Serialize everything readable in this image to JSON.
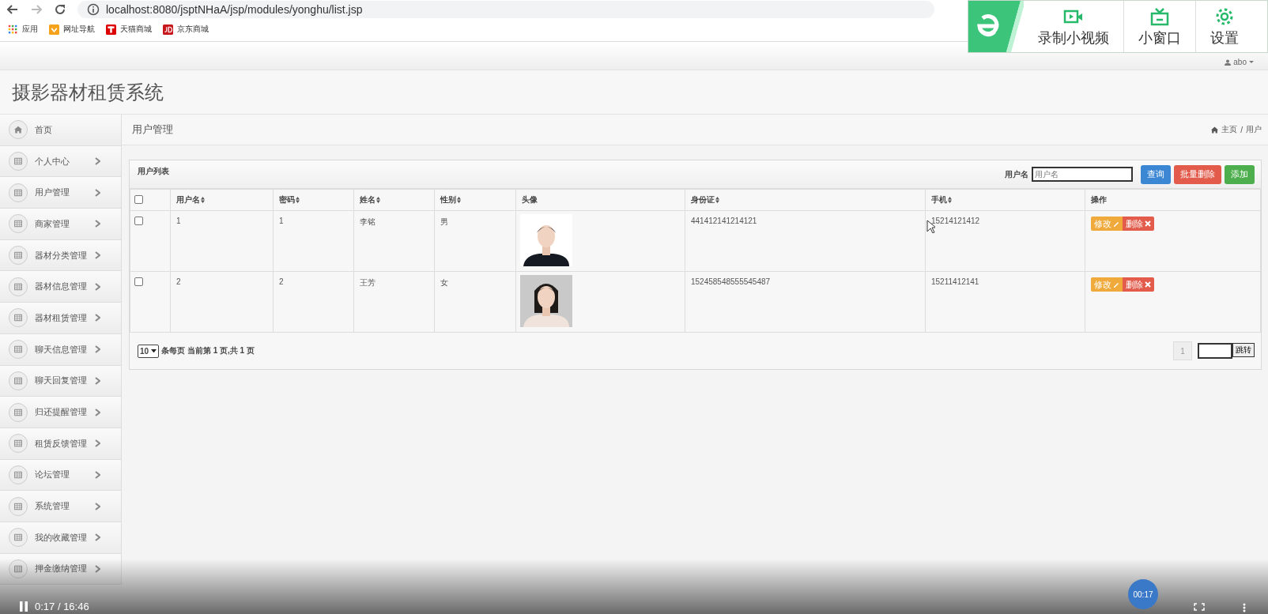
{
  "browser": {
    "url": "localhost:8080/jsptNHaA/jsp/modules/yonghu/list.jsp",
    "bookmarks": [
      {
        "label": "应用",
        "kind": "apps"
      },
      {
        "label": "网址导航",
        "kind": "nav"
      },
      {
        "label": "天猫商城",
        "kind": "tmall"
      },
      {
        "label": "京东商城",
        "kind": "jd"
      }
    ]
  },
  "extension_toolbar": {
    "items": [
      {
        "label": "录制小视频",
        "kind": "record"
      },
      {
        "label": "小窗口",
        "kind": "mini"
      },
      {
        "label": "设置",
        "kind": "settings"
      }
    ]
  },
  "header": {
    "user": "abo",
    "title": "摄影器材租赁系统"
  },
  "sidebar": {
    "items": [
      {
        "label": "首页",
        "kind": "home",
        "has_submenu": false
      },
      {
        "label": "个人中心",
        "kind": "table",
        "has_submenu": true
      },
      {
        "label": "用户管理",
        "kind": "table",
        "has_submenu": true
      },
      {
        "label": "商家管理",
        "kind": "table",
        "has_submenu": true
      },
      {
        "label": "器材分类管理",
        "kind": "table",
        "has_submenu": true
      },
      {
        "label": "器材信息管理",
        "kind": "table",
        "has_submenu": true
      },
      {
        "label": "器材租赁管理",
        "kind": "table",
        "has_submenu": true
      },
      {
        "label": "聊天信息管理",
        "kind": "table",
        "has_submenu": true
      },
      {
        "label": "聊天回复管理",
        "kind": "table",
        "has_submenu": true
      },
      {
        "label": "归还提醒管理",
        "kind": "table",
        "has_submenu": true
      },
      {
        "label": "租赁反馈管理",
        "kind": "table",
        "has_submenu": true
      },
      {
        "label": "论坛管理",
        "kind": "table",
        "has_submenu": true
      },
      {
        "label": "系统管理",
        "kind": "table",
        "has_submenu": true
      },
      {
        "label": "我的收藏管理",
        "kind": "table",
        "has_submenu": true
      },
      {
        "label": "押金缴纳管理",
        "kind": "table",
        "has_submenu": true
      }
    ]
  },
  "breadcrumb": {
    "page_title": "用户管理",
    "trail": [
      "主页",
      "用户"
    ],
    "separator": "/"
  },
  "panel": {
    "title": "用户列表",
    "search": {
      "label": "用户名",
      "placeholder": "用户名"
    },
    "buttons": [
      {
        "label": "查询",
        "kind": "query"
      },
      {
        "label": "批量删除",
        "kind": "batch_delete"
      },
      {
        "label": "添加",
        "kind": "add"
      }
    ]
  },
  "table": {
    "select_all": {
      "checked": false
    },
    "columns": [
      {
        "label": "用户名",
        "sortable": true
      },
      {
        "label": "密码",
        "sortable": true
      },
      {
        "label": "姓名",
        "sortable": true
      },
      {
        "label": "性别",
        "sortable": true
      },
      {
        "label": "头像",
        "sortable": false
      },
      {
        "label": "身份证",
        "sortable": true
      },
      {
        "label": "手机",
        "sortable": true
      },
      {
        "label": "操作",
        "sortable": false
      }
    ],
    "rows": [
      {
        "checked": false,
        "cells": [
          "1",
          "1",
          "李铭",
          "男",
          {
            "kind": "picture"
          },
          "441412141214121",
          "15214121412"
        ],
        "actions": [
          {
            "label": "修改",
            "kind": "edit"
          },
          {
            "label": "删除",
            "kind": "delete"
          }
        ]
      },
      {
        "checked": false,
        "cells": [
          "2",
          "2",
          "王芳",
          "女",
          {
            "kind": "picture"
          },
          "152458548555545487",
          "15211412141"
        ],
        "actions": [
          {
            "label": "修改",
            "kind": "edit"
          },
          {
            "label": "删除",
            "kind": "delete"
          }
        ]
      }
    ]
  },
  "pagination": {
    "page_size": "10",
    "summary": "条每页 当前第 1 页,共 1 页",
    "pages": [
      {
        "label": "1",
        "selected": true
      }
    ],
    "jump_label": "跳转"
  },
  "video": {
    "time": "0:17 / 16:46",
    "badge": "00:17"
  }
}
